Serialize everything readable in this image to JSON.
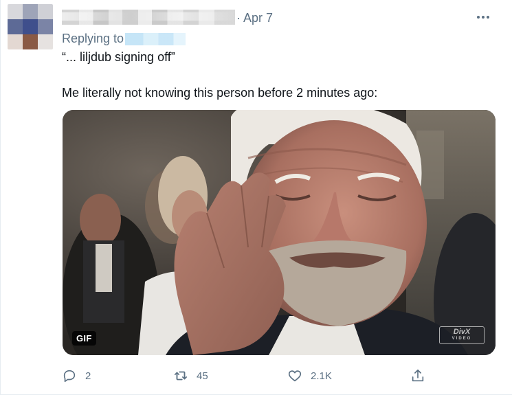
{
  "tweet": {
    "date": "· Apr 7",
    "replying_prefix": "Replying to",
    "quote_text": "“... liljdub signing off”",
    "body_text": "Me literally not knowing this person before 2 minutes ago:"
  },
  "media": {
    "gif_badge": "GIF",
    "watermark": "DivX",
    "watermark_sub": "VIDEO"
  },
  "actions": {
    "reply_count": "2",
    "retweet_count": "45",
    "like_count": "2.1K"
  },
  "icons": {
    "more": "more-dots-icon",
    "reply": "reply-icon",
    "retweet": "retweet-icon",
    "like": "heart-icon",
    "share": "share-icon"
  },
  "colors": {
    "secondary_text": "#5b7083",
    "primary_text": "#0f1419",
    "link_blur": "#c4e4f7"
  }
}
